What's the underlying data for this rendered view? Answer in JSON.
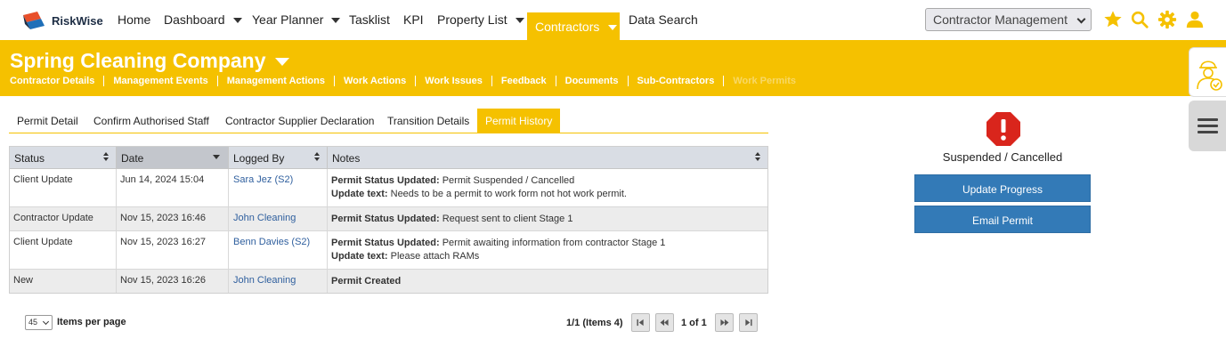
{
  "app": {
    "name": "RiskWise"
  },
  "nav": {
    "items": [
      {
        "label": "Home",
        "dropdown": false
      },
      {
        "label": "Dashboard",
        "dropdown": true
      },
      {
        "label": "Year Planner",
        "dropdown": true
      },
      {
        "label": "Tasklist",
        "dropdown": false
      },
      {
        "label": "KPI",
        "dropdown": false
      },
      {
        "label": "Property List",
        "dropdown": true
      },
      {
        "label": "Contractors",
        "dropdown": true,
        "active": true
      },
      {
        "label": "Data Search",
        "dropdown": false
      }
    ],
    "module_select": {
      "value": "Contractor Management"
    },
    "icons": [
      "star-icon",
      "search-icon",
      "gear-icon",
      "user-icon"
    ]
  },
  "header": {
    "company": "Spring Cleaning Company",
    "subnav": [
      "Contractor Details",
      "Management Events",
      "Management Actions",
      "Work Actions",
      "Work Issues",
      "Feedback",
      "Documents",
      "Sub-Contractors",
      "Work Permits"
    ],
    "accent": "#f5c100"
  },
  "tabs": [
    "Permit Detail",
    "Confirm Authorised Staff",
    "Contractor Supplier Declaration",
    "Transition Details",
    "Permit History"
  ],
  "active_tab": "Permit History",
  "table": {
    "columns": [
      "Status",
      "Date",
      "Logged By",
      "Notes"
    ],
    "rows": [
      {
        "status": "Client Update",
        "date": "Jun 14, 2024 15:04",
        "logged_by": "Sara Jez (S2)",
        "notes": [
          {
            "label": "Permit Status Updated:",
            "text": " Permit Suspended / Cancelled"
          },
          {
            "label": "Update text:",
            "text": " Needs to be a permit to work form not hot work permit."
          }
        ]
      },
      {
        "status": "Contractor Update",
        "date": "Nov 15, 2023 16:46",
        "logged_by": "John Cleaning",
        "notes": [
          {
            "label": "Permit Status Updated:",
            "text": " Request sent to client Stage 1"
          }
        ]
      },
      {
        "status": "Client Update",
        "date": "Nov 15, 2023 16:27",
        "logged_by": "Benn Davies (S2)",
        "notes": [
          {
            "label": "Permit Status Updated:",
            "text": " Permit awaiting information from contractor Stage 1"
          },
          {
            "label": "Update text:",
            "text": " Please attach RAMs"
          }
        ]
      },
      {
        "status": "New",
        "date": "Nov 15, 2023 16:26",
        "logged_by": "John Cleaning",
        "notes": [
          {
            "label": "Permit Created",
            "text": ""
          }
        ]
      }
    ]
  },
  "pager": {
    "per_page": "45",
    "per_page_label": "Items per page",
    "info": "1/1 (Items 4)",
    "page": "1 of 1"
  },
  "status_panel": {
    "status": "Suspended / Cancelled",
    "buttons": [
      "Update Progress",
      "Email Permit"
    ],
    "icon": "alert-octagon-icon",
    "alert_color": "#d9251c",
    "button_color": "#337ab7"
  }
}
